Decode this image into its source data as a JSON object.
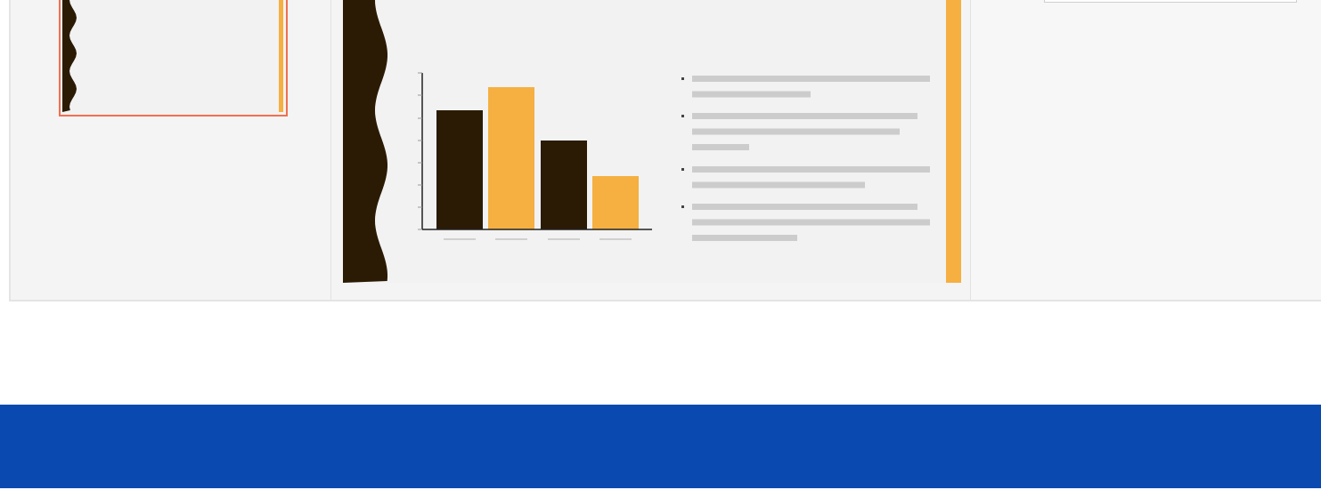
{
  "thumbnails": [
    {
      "selected": true
    }
  ]
}
